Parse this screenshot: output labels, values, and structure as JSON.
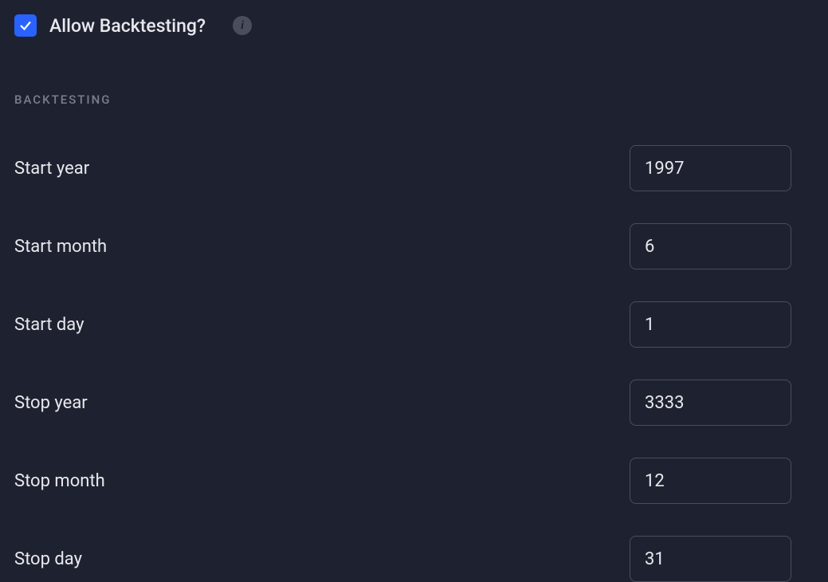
{
  "header": {
    "checkbox_checked": true,
    "label": "Allow Backtesting?"
  },
  "section_title": "BACKTESTING",
  "fields": {
    "start_year": {
      "label": "Start year",
      "value": "1997"
    },
    "start_month": {
      "label": "Start month",
      "value": "6"
    },
    "start_day": {
      "label": "Start day",
      "value": "1"
    },
    "stop_year": {
      "label": "Stop year",
      "value": "3333"
    },
    "stop_month": {
      "label": "Stop month",
      "value": "12"
    },
    "stop_day": {
      "label": "Stop day",
      "value": "31"
    }
  }
}
